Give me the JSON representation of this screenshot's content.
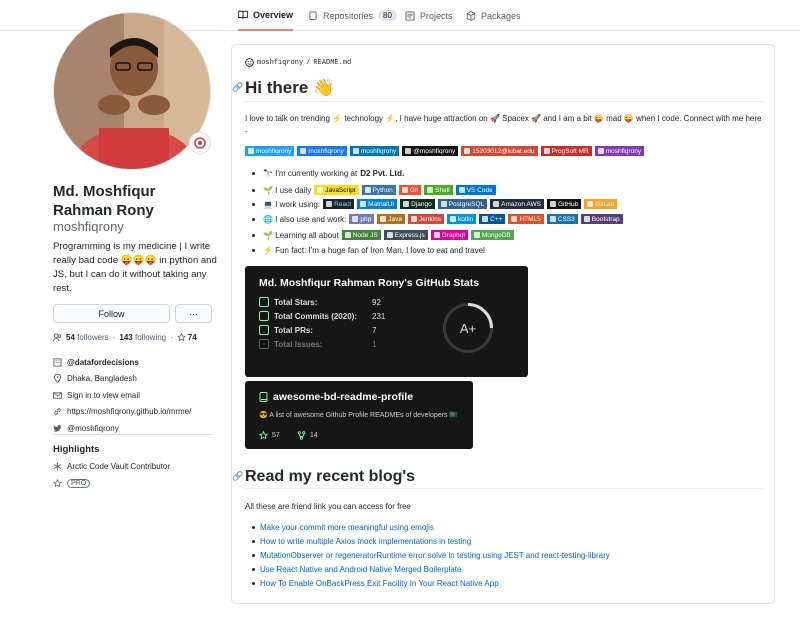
{
  "nav": {
    "tabs": [
      {
        "label": "Overview"
      },
      {
        "label": "Repositories",
        "count": "80"
      },
      {
        "label": "Projects"
      },
      {
        "label": "Packages"
      }
    ]
  },
  "profile": {
    "name": "Md. Moshfiqur Rahman Rony",
    "name_line1": "Md. Moshfiqur",
    "name_line2": "Rahman Rony",
    "login": "moshfiqrony",
    "bio": "Programming is my medicine | I write really bad code 😛😛😛 in python and JS, but I can do it without taking any rest.",
    "follow_label": "Follow",
    "more_label": "···",
    "followers_count": "54",
    "followers_label": "followers",
    "following_count": "143",
    "following_label": "following",
    "stars_count": "74",
    "org": "@datafordecisions",
    "location": "Dhaka, Bangladesh",
    "email": "Sign in to view email",
    "website": "https://moshfiqrony.github.io/mrme/",
    "twitter": "@moshfiqrony"
  },
  "highlights": {
    "title": "Highlights",
    "arctic": "Arctic Code Vault Contributor",
    "pro": "PRO"
  },
  "readme": {
    "owner": "moshfiqrony",
    "slash": "/",
    "file": "README.md",
    "hi": "Hi there 👋",
    "intro": "I love to talk on trending ⚡ technology ⚡, I have huge attraction on 🚀 Spacex 🚀 and I am a bit 😜 mad 😜 when I code. Connect with me here -",
    "social_badges": [
      {
        "label": "moshfiqrony",
        "color": "#1da1f2"
      },
      {
        "label": "moshfiqrony",
        "color": "#1877f2"
      },
      {
        "label": "moshfiqrony",
        "color": "#0077b5"
      },
      {
        "label": "@moshfiqrony",
        "color": "#111111"
      },
      {
        "label": "15203012@iubat.edu",
        "color": "#d14836"
      },
      {
        "label": "ProgSoft MR",
        "color": "#c4302b"
      },
      {
        "label": "moshfiqrony",
        "color": "#833ab4"
      }
    ],
    "bullets": [
      {
        "prefix": "🔭 I'm currently working at",
        "bold": "D2 Pvt. Ltd.",
        "badges": []
      },
      {
        "prefix": "🌱 I use daily",
        "bold": "",
        "badges": [
          {
            "label": "JavaScript",
            "color": "#f7df1e",
            "text": "#000000"
          },
          {
            "label": "Python",
            "color": "#3776ab",
            "text": "#ffffff"
          },
          {
            "label": "Git",
            "color": "#f05033",
            "text": "#ffffff"
          },
          {
            "label": "Shell",
            "color": "#4eaa25",
            "text": "#ffffff"
          },
          {
            "label": "VS Code",
            "color": "#0078d7",
            "text": "#ffffff"
          }
        ]
      },
      {
        "prefix": "💻 I work using:",
        "bold": "",
        "badges": [
          {
            "label": "React",
            "color": "#20232a",
            "text": "#61dafb"
          },
          {
            "label": "MatrialUI",
            "color": "#0081cb",
            "text": "#ffffff"
          },
          {
            "label": "Django",
            "color": "#092e20",
            "text": "#ffffff"
          },
          {
            "label": "PostgreSQL",
            "color": "#316192",
            "text": "#ffffff"
          },
          {
            "label": "Amazon AWS",
            "color": "#232f3e",
            "text": "#ffffff"
          },
          {
            "label": "GitHub",
            "color": "#121011",
            "text": "#ffffff"
          },
          {
            "label": "GitLab",
            "color": "#fca121",
            "text": "#ffffff"
          }
        ]
      },
      {
        "prefix": "🌐 I also use and work:",
        "bold": "",
        "badges": [
          {
            "label": "php",
            "color": "#777bb4",
            "text": "#ffffff"
          },
          {
            "label": "Java",
            "color": "#b07219",
            "text": "#ffffff"
          },
          {
            "label": "Jenkins",
            "color": "#d24939",
            "text": "#ffffff"
          },
          {
            "label": "kotlin",
            "color": "#0095d5",
            "text": "#ffffff"
          },
          {
            "label": "C++",
            "color": "#00599c",
            "text": "#ffffff"
          },
          {
            "label": "HTML5",
            "color": "#e34f26",
            "text": "#ffffff"
          },
          {
            "label": "CSS3",
            "color": "#1572b6",
            "text": "#ffffff"
          },
          {
            "label": "Bootstrap",
            "color": "#563d7c",
            "text": "#ffffff"
          }
        ]
      },
      {
        "prefix": "🌱 Learning all about",
        "bold": "",
        "badges": [
          {
            "label": "Node JS",
            "color": "#43853d",
            "text": "#ffffff"
          },
          {
            "label": "Express.js",
            "color": "#404d59",
            "text": "#ffffff"
          },
          {
            "label": "Graphql",
            "color": "#e10098",
            "text": "#ffffff"
          },
          {
            "label": "MongoDB",
            "color": "#4ea94b",
            "text": "#ffffff"
          }
        ]
      },
      {
        "prefix": "⚡ Fun fact: I'm a huge fan of Iron Man, I love to eat and travel",
        "bold": "",
        "badges": []
      }
    ],
    "stats": {
      "title": "Md. Moshfiqur Rahman Rony's GitHub Stats",
      "rows": [
        {
          "label": "Total Stars:",
          "value": "92"
        },
        {
          "label": "Total Commits (2020):",
          "value": "231"
        },
        {
          "label": "Total PRs:",
          "value": "7"
        },
        {
          "label": "Total Issues:",
          "value": "1"
        }
      ],
      "grade": "A+",
      "accent": "#79ff97"
    },
    "repo_card": {
      "name": "awesome-bd-readme-profile",
      "desc": "😎 A list of awesome Github Profile READMEs of developers 🇧🇩",
      "stars": "57",
      "forks": "14"
    },
    "blog": {
      "title": "Read my recent blog's",
      "subtitle": "All these are friend link you can access for free",
      "links": [
        "Make your commit more meaningful using emojis",
        "How to write multiple Axios mock implementations in testing",
        "MutationObserver or regeneratorRuntime error solve in testing using JEST and react-testing-library",
        "Use React Native and Android Native Merged Boilerplate",
        "How To Enable OnBackPress Exit Facility In Your React Native App"
      ]
    }
  }
}
